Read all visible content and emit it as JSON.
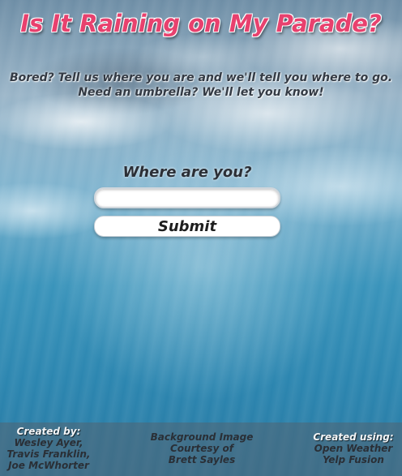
{
  "header": {
    "title": "Is It Raining on My Parade?",
    "tagline_line1": "Bored? Tell us where you are and we'll tell you where to go.",
    "tagline_line2": "Need an umbrella? We'll let you know!"
  },
  "form": {
    "label": "Where are you?",
    "input_value": "",
    "input_placeholder": "",
    "submit_label": "Submit"
  },
  "footer": {
    "credits": {
      "heading": "Created by:",
      "lines": [
        "Wesley Ayer,",
        "Travis Franklin,",
        "Joe McWhorter"
      ]
    },
    "background": {
      "lines": [
        "Background Image",
        "Courtesy of",
        "Brett Sayles"
      ]
    },
    "apis": {
      "heading": "Created using:",
      "lines": [
        "Open Weather",
        "Yelp Fusion"
      ]
    }
  },
  "colors": {
    "title": "#e8416e",
    "text_dark": "#2b2f36",
    "footer_overlay": "#50647380"
  }
}
